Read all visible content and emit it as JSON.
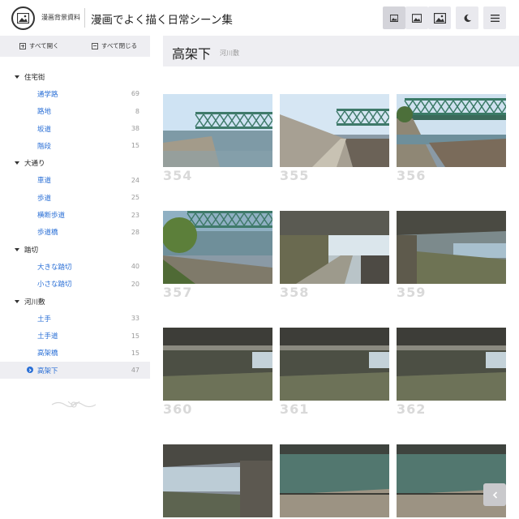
{
  "header": {
    "site_name": "漫画背景資料",
    "site_title": "漫画でよく描く日常シーン集",
    "buttons": [
      {
        "name": "image-small-view-button",
        "icon": "image-icon"
      },
      {
        "name": "image-medium-view-button",
        "icon": "image-icon"
      },
      {
        "name": "image-large-view-button",
        "icon": "image-icon"
      },
      {
        "name": "dark-mode-button",
        "icon": "moon-icon"
      },
      {
        "name": "menu-button",
        "icon": "hamburger-icon"
      }
    ]
  },
  "sidebar": {
    "expand_all": "すべて開く",
    "collapse_all": "すべて閉じる",
    "categories": [
      {
        "label": "住宅街",
        "items": [
          {
            "label": "通学路",
            "count": "69"
          },
          {
            "label": "路地",
            "count": "8"
          },
          {
            "label": "坂道",
            "count": "38"
          },
          {
            "label": "階段",
            "count": "15"
          }
        ]
      },
      {
        "label": "大通り",
        "items": [
          {
            "label": "車道",
            "count": "24"
          },
          {
            "label": "歩道",
            "count": "25"
          },
          {
            "label": "横断歩道",
            "count": "23"
          },
          {
            "label": "歩道橋",
            "count": "28"
          }
        ]
      },
      {
        "label": "踏切",
        "items": [
          {
            "label": "大きな踏切",
            "count": "40"
          },
          {
            "label": "小さな踏切",
            "count": "20"
          }
        ]
      },
      {
        "label": "河川敷",
        "items": [
          {
            "label": "土手",
            "count": "33"
          },
          {
            "label": "土手道",
            "count": "15"
          },
          {
            "label": "高架橋",
            "count": "15"
          },
          {
            "label": "高架下",
            "count": "47",
            "selected": true
          }
        ]
      }
    ]
  },
  "main": {
    "title": "高架下",
    "subtitle": "河川敷",
    "photos": [
      {
        "number": "354",
        "scene": "bridge-far"
      },
      {
        "number": "355",
        "scene": "bridge-path"
      },
      {
        "number": "356",
        "scene": "bridge-near"
      },
      {
        "number": "357",
        "scene": "river-bank"
      },
      {
        "number": "358",
        "scene": "under-bright"
      },
      {
        "number": "359",
        "scene": "under-river"
      },
      {
        "number": "360",
        "scene": "under-dark"
      },
      {
        "number": "361",
        "scene": "under-dark"
      },
      {
        "number": "362",
        "scene": "under-dark"
      },
      {
        "number": "",
        "scene": "under-left"
      },
      {
        "number": "",
        "scene": "river-walk"
      },
      {
        "number": "",
        "scene": "river-walk"
      }
    ],
    "back_icon": "chevron-left-icon"
  },
  "colors": {
    "link": "#2a6fd6",
    "count": "#999999",
    "number": "#d9d9d9",
    "panel": "#eeeef2"
  }
}
